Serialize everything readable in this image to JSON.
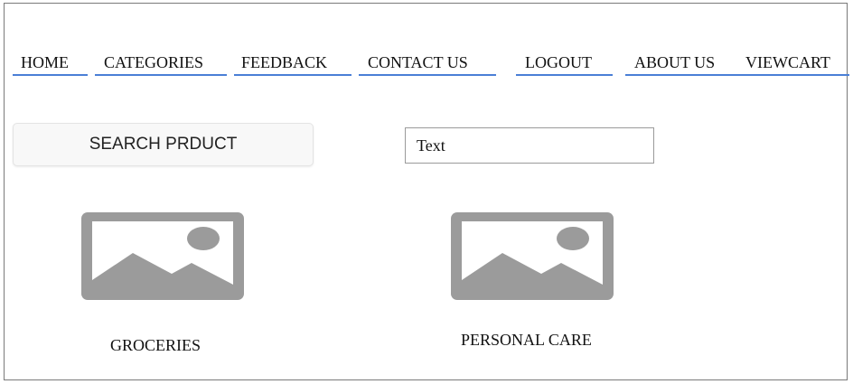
{
  "nav": {
    "items": [
      {
        "label": "HOME"
      },
      {
        "label": "CATEGORIES"
      },
      {
        "label": "FEEDBACK"
      },
      {
        "label": "CONTACT US"
      },
      {
        "label": "LOGOUT"
      },
      {
        "label": "ABOUT US"
      },
      {
        "label": "VIEWCART"
      }
    ]
  },
  "search": {
    "button_label": "SEARCH PRDUCT",
    "input_value": "Text"
  },
  "categories": [
    {
      "label": "GROCERIES",
      "icon": "image-placeholder-icon"
    },
    {
      "label": "PERSONAL CARE",
      "icon": "image-placeholder-icon"
    }
  ],
  "colors": {
    "nav_underline": "#4a7fd6",
    "placeholder_gray": "#9b9b9b",
    "border": "#7a7a7a"
  }
}
